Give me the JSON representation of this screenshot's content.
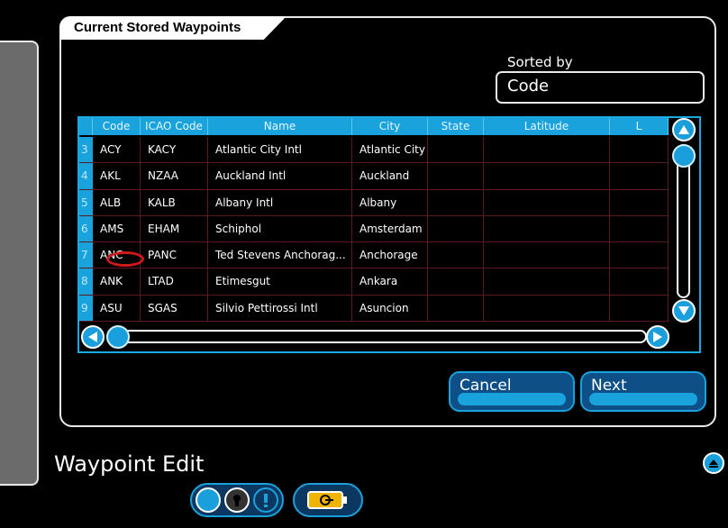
{
  "panel": {
    "title": "Current Stored Waypoints"
  },
  "sort": {
    "label": "Sorted by",
    "value": "Code"
  },
  "table": {
    "headers": [
      "",
      "Code",
      "ICAO Code",
      "Name",
      "City",
      "State",
      "Latitude",
      "L"
    ],
    "rows": [
      {
        "num": "3",
        "code": "ACY",
        "icao": "KACY",
        "name": "Atlantic City Intl",
        "city": "Atlantic City",
        "state": "",
        "lat": ""
      },
      {
        "num": "4",
        "code": "AKL",
        "icao": "NZAA",
        "name": "Auckland Intl",
        "city": "Auckland",
        "state": "",
        "lat": ""
      },
      {
        "num": "5",
        "code": "ALB",
        "icao": "KALB",
        "name": "Albany Intl",
        "city": "Albany",
        "state": "",
        "lat": ""
      },
      {
        "num": "6",
        "code": "AMS",
        "icao": "EHAM",
        "name": "Schiphol",
        "city": "Amsterdam",
        "state": "",
        "lat": ""
      },
      {
        "num": "7",
        "code": "ANC",
        "icao": "PANC",
        "name": "Ted Stevens Anchorag...",
        "city": "Anchorage",
        "state": "",
        "lat": ""
      },
      {
        "num": "8",
        "code": "ANK",
        "icao": "LTAD",
        "name": "Etimesgut",
        "city": "Ankara",
        "state": "",
        "lat": ""
      },
      {
        "num": "9",
        "code": "ASU",
        "icao": "SGAS",
        "name": "Silvio Pettirossi Intl",
        "city": "Asuncion",
        "state": "",
        "lat": ""
      }
    ]
  },
  "buttons": {
    "cancel": "Cancel",
    "next": "Next"
  },
  "footer": {
    "title": "Waypoint Edit"
  },
  "colors": {
    "accent": "#1aa2dc",
    "highlight": "#d01a1a"
  }
}
